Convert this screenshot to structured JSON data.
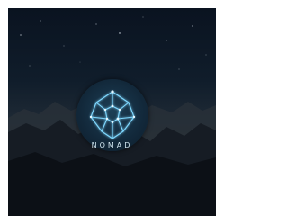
{
  "logo": {
    "wordmark": "NOMAD",
    "icon": "constellation-diamond-icon"
  },
  "colors": {
    "sky_top": "#0a1320",
    "horizon_glow": "#3a3630",
    "emblem_fill": "#12283a",
    "glow_line": "#7fd8ff",
    "text": "#cfe4ee"
  }
}
